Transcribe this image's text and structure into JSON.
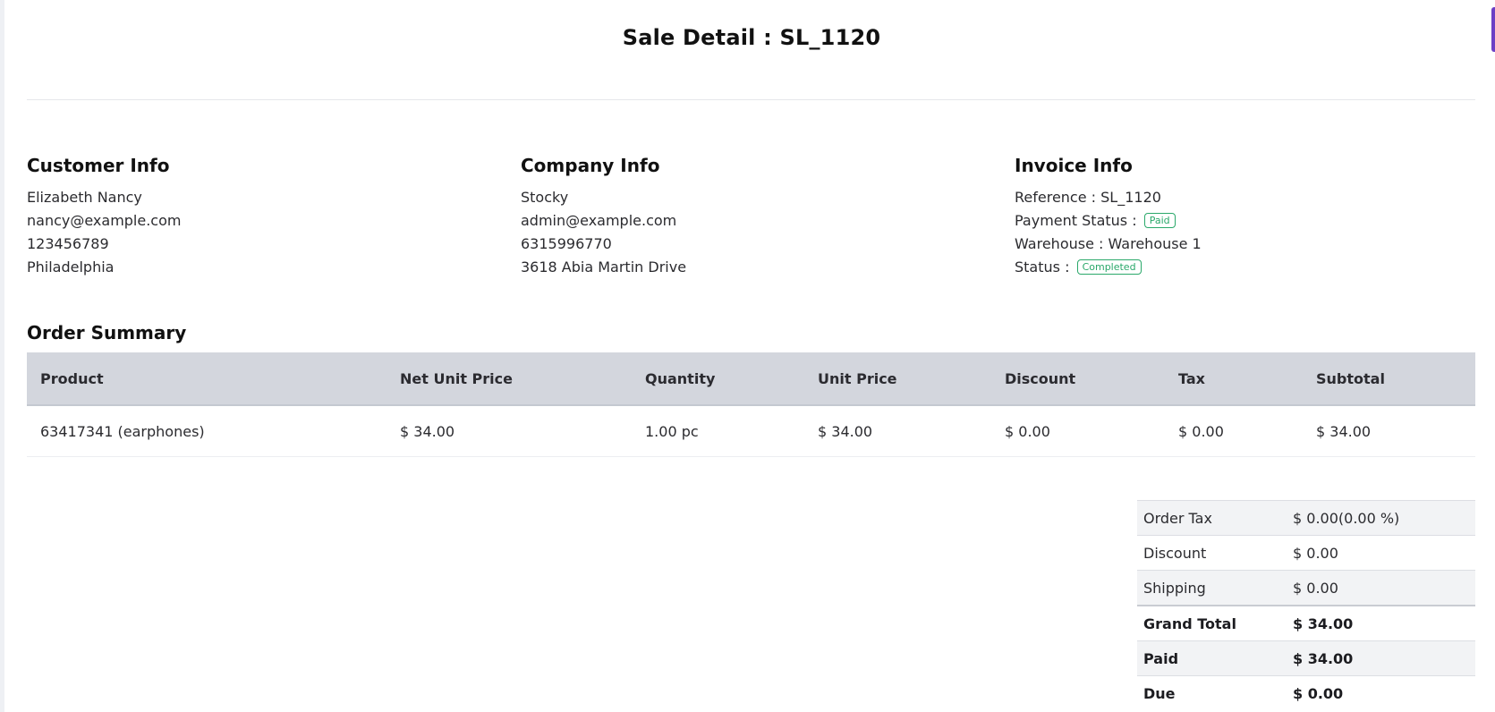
{
  "page": {
    "title": "Sale Detail : SL_1120"
  },
  "customer": {
    "heading": "Customer Info",
    "name": "Elizabeth Nancy",
    "email": "nancy@example.com",
    "phone": "123456789",
    "city": "Philadelphia"
  },
  "company": {
    "heading": "Company Info",
    "name": "Stocky",
    "email": "admin@example.com",
    "phone": "6315996770",
    "address": "3618 Abia Martin Drive"
  },
  "invoice": {
    "heading": "Invoice Info",
    "reference_label": "Reference :",
    "reference_value": "SL_1120",
    "payment_status_label": "Payment Status :",
    "payment_status_value": "Paid",
    "warehouse_label": "Warehouse :",
    "warehouse_value": "Warehouse 1",
    "status_label": "Status :",
    "status_value": "Completed"
  },
  "order": {
    "heading": "Order Summary",
    "columns": [
      "Product",
      "Net Unit Price",
      "Quantity",
      "Unit Price",
      "Discount",
      "Tax",
      "Subtotal"
    ],
    "rows": [
      [
        "63417341 (earphones)",
        "$ 34.00",
        "1.00 pc",
        "$ 34.00",
        "$ 0.00",
        "$ 0.00",
        "$ 34.00"
      ]
    ]
  },
  "summary": {
    "order_tax_label": "Order Tax",
    "order_tax_value": "$ 0.00(0.00 %)",
    "discount_label": "Discount",
    "discount_value": "$ 0.00",
    "shipping_label": "Shipping",
    "shipping_value": "$ 0.00",
    "grand_total_label": "Grand Total",
    "grand_total_value": "$ 34.00",
    "paid_label": "Paid",
    "paid_value": "$ 34.00",
    "due_label": "Due",
    "due_value": "$ 0.00"
  },
  "colors": {
    "badge_green": "#2aa86a",
    "table_header_bg": "#d3d6dd",
    "accent_purple": "#6c3fc5"
  }
}
